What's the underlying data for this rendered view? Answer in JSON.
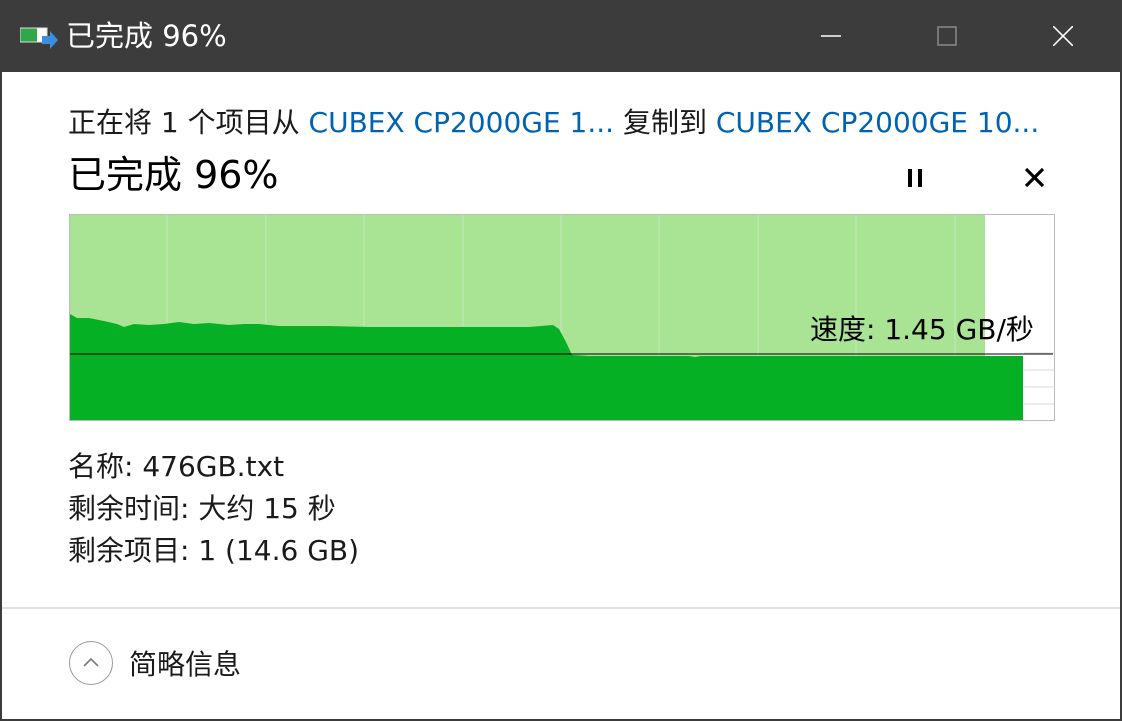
{
  "window": {
    "title": "已完成 96%",
    "icon": "file-copy-icon"
  },
  "titlebar_buttons": {
    "minimize_icon": "minimize-icon",
    "maximize_icon": "maximize-icon",
    "close_icon": "close-icon"
  },
  "copy": {
    "prefix": "正在将 1 个项目从 ",
    "source": "CUBEX CP2000GE 1...",
    "middle": " 复制到 ",
    "destination": "CUBEX CP2000GE 10..."
  },
  "progress": {
    "percent_label": "已完成 96%",
    "percent_value": 96,
    "pause_icon": "pause-icon",
    "cancel_icon": "cancel-icon"
  },
  "graph": {
    "speed_label": "速度: 1.45 GB/秒",
    "colors": {
      "progress_fill": "#a8e494",
      "speed_fill": "#06b025",
      "grid": "#c8e6c0",
      "speed_line": "#000000",
      "border": "#bcbcbc"
    }
  },
  "details": {
    "name": "名称: 476GB.txt",
    "time_remaining": "剩余时间: 大约 15 秒",
    "items_remaining": "剩余项目: 1 (14.6 GB)"
  },
  "footer": {
    "toggle_icon": "chevron-up-icon",
    "toggle_label": "简略信息"
  }
}
